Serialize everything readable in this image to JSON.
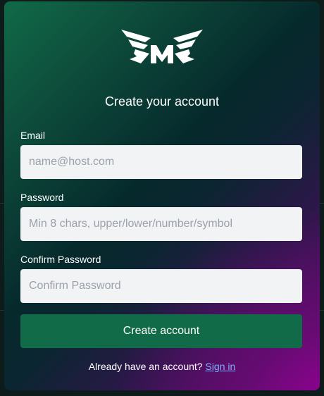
{
  "form": {
    "title": "Create your account",
    "email_label": "Email",
    "email_placeholder": "name@host.com",
    "email_value": "",
    "password_label": "Password",
    "password_placeholder": "Min 8 chars, upper/lower/number/symbol",
    "password_value": "",
    "confirm_label": "Confirm Password",
    "confirm_placeholder": "Confirm Password",
    "confirm_value": "",
    "submit_label": "Create account",
    "footer_text": "Already have an account?",
    "signin_link": "Sign in"
  },
  "colors": {
    "accent": "#116a48",
    "link": "#7fb0ff",
    "field_bg": "#f2f3f5"
  },
  "icons": {
    "logo": "winged-m-logo-icon"
  }
}
